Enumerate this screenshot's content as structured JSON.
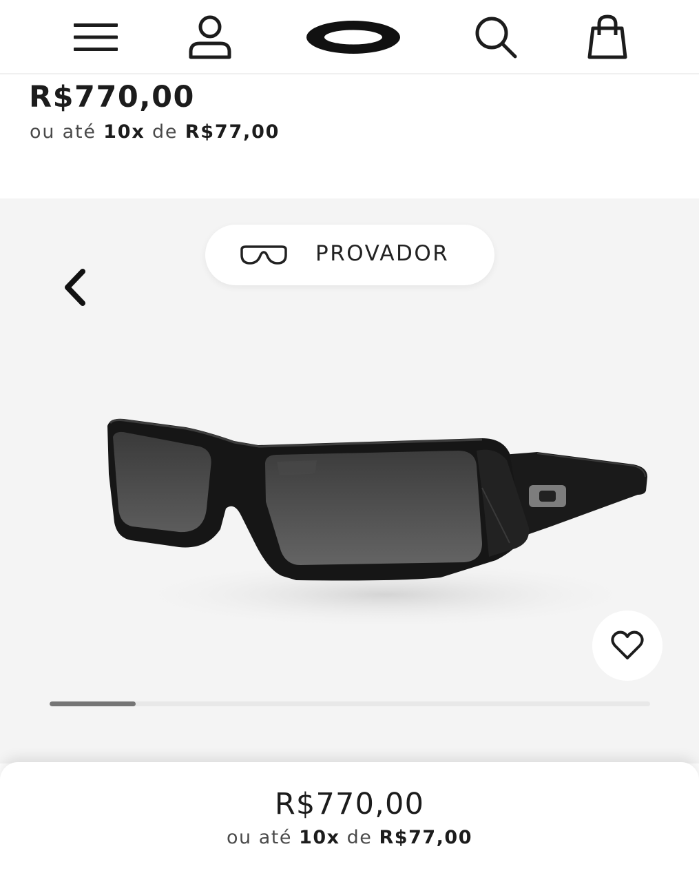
{
  "header": {
    "menu_icon": "hamburger-menu-icon",
    "account_icon": "user-icon",
    "brand_logo": "oakley-ellipse-logo",
    "search_icon": "search-icon",
    "cart_icon": "shopping-bag-icon"
  },
  "pricing_top": {
    "price": "R$770,00",
    "installment_prefix": "ou até",
    "installment_count": "10x",
    "installment_mid": "de",
    "installment_value": "R$77,00"
  },
  "gallery": {
    "try_on_label": "PROVADOR",
    "try_on_icon": "glasses-icon",
    "prev_icon": "chevron-left-icon",
    "favorite_icon": "heart-icon",
    "image_progress": 0.143
  },
  "pricing_bottom": {
    "price": "R$770,00",
    "installment_prefix": "ou até",
    "installment_count": "10x",
    "installment_mid": "de",
    "installment_value": "R$77,00"
  },
  "colors": {
    "text": "#1c1c1c",
    "gallery_bg": "#f4f4f4",
    "progress_fill": "#757575"
  }
}
